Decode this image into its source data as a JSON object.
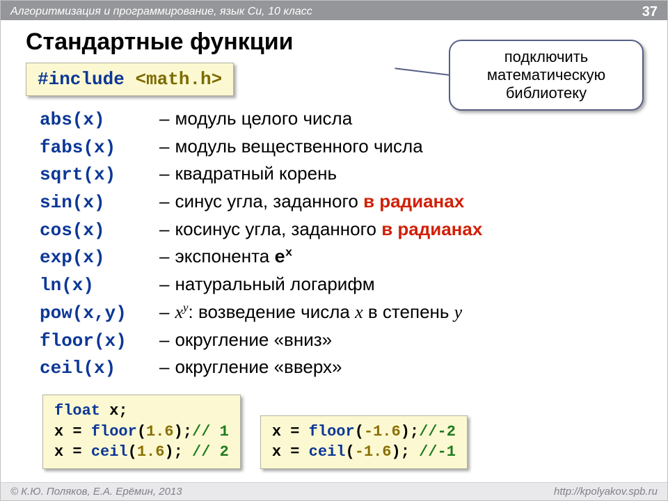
{
  "header": {
    "course": "Алгоритмизация и программирование, язык Си, 10 класс",
    "page": "37"
  },
  "title": "Стандартные функции",
  "include": {
    "directive": "#include",
    "header": "<math.h>"
  },
  "callout": "подключить математическую библиотеку",
  "funcs": [
    {
      "code": "abs(x)",
      "type": "plain",
      "desc": "модуль целого числа"
    },
    {
      "code": "fabs(x)",
      "type": "plain",
      "desc": "модуль вещественного числа"
    },
    {
      "code": "sqrt(x)",
      "type": "plain",
      "desc": "квадратный корень"
    },
    {
      "code": "sin(x)",
      "type": "angle",
      "desc_prefix": "синус угла, заданного ",
      "em": "в радианах"
    },
    {
      "code": "cos(x)",
      "type": "angle",
      "desc_prefix": "косинус угла, заданного ",
      "em": "в радианах"
    },
    {
      "code": "exp(x)",
      "type": "exp",
      "desc_prefix": "экспонента ",
      "base": "e",
      "sup": "x"
    },
    {
      "code": "ln(x)",
      "type": "plain",
      "desc": "натуральный логарифм"
    },
    {
      "code": "pow(x,y)",
      "type": "pow",
      "base": "x",
      "sup": "y",
      "after": ": возведение числа ",
      "var1": "x",
      "mid": " в степень ",
      "var2": "y"
    },
    {
      "code": "floor(x)",
      "type": "plain",
      "desc": "округление «вниз»"
    },
    {
      "code": "ceil(x)",
      "type": "plain",
      "desc": "округление «вверх»"
    }
  ],
  "boxA": {
    "line1a": "float",
    "line1b": " x;",
    "line2pre": "x = ",
    "line2fn": "floor",
    "line2mid": "(",
    "line2num": "1.6",
    "line2post": ");",
    "line2cmt": "// 1",
    "line3pre": "x = ",
    "line3fn": "ceil",
    "line3mid": "(",
    "line3num": "1.6",
    "line3post": "); ",
    "line3cmt": "// 2"
  },
  "boxB": {
    "line1pre": "x = ",
    "line1fn": "floor",
    "line1mid": "(",
    "line1num": "-1.6",
    "line1post": ");",
    "line1cmt": "//-2",
    "line2pre": "x = ",
    "line2fn": "ceil",
    "line2mid": "(",
    "line2num": "-1.6",
    "line2post": "); ",
    "line2cmt": "//-1"
  },
  "footer": {
    "left": "© К.Ю. Поляков, Е.А. Ерёмин, 2013",
    "right": "http://kpolyakov.spb.ru"
  }
}
